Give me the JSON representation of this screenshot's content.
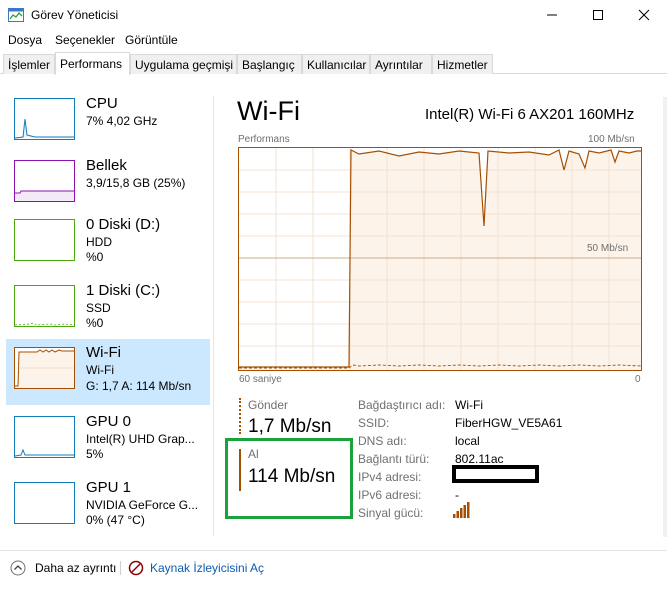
{
  "window": {
    "title": "Görev Yöneticisi",
    "icon": "task-manager-icon"
  },
  "menu": [
    "Dosya",
    "Seçenekler",
    "Görüntüle"
  ],
  "tabs": [
    {
      "label": "İşlemler",
      "active": false
    },
    {
      "label": "Performans",
      "active": true
    },
    {
      "label": "Uygulama geçmişi",
      "active": false
    },
    {
      "label": "Başlangıç",
      "active": false
    },
    {
      "label": "Kullanıcılar",
      "active": false
    },
    {
      "label": "Ayrıntılar",
      "active": false
    },
    {
      "label": "Hizmetler",
      "active": false
    }
  ],
  "sidebar": [
    {
      "name": "CPU",
      "sub1": "7% 4,02 GHz",
      "sub2": "",
      "sub3": "",
      "color": "#117dbb",
      "selected": false
    },
    {
      "name": "Bellek",
      "sub1": "3,9/15,8 GB (25%)",
      "sub2": "",
      "sub3": "",
      "color": "#8b12ae",
      "selected": false
    },
    {
      "name": "0 Diski (D:)",
      "sub1": "HDD",
      "sub2": "%0",
      "sub3": "",
      "color": "#4da60c",
      "selected": false
    },
    {
      "name": "1 Diski (C:)",
      "sub1": "SSD",
      "sub2": "%0",
      "sub3": "",
      "color": "#4da60c",
      "selected": false
    },
    {
      "name": "Wi-Fi",
      "sub1": "Wi-Fi",
      "sub2": "G: 1,7 A: 114 Mb/sn",
      "sub3": "",
      "color": "#a74f01",
      "selected": true
    },
    {
      "name": "GPU 0",
      "sub1": "Intel(R) UHD Grap...",
      "sub2": "5%",
      "sub3": "",
      "color": "#117dbb",
      "selected": false
    },
    {
      "name": "GPU 1",
      "sub1": "NVIDIA GeForce G...",
      "sub2": "0% (47 °C)",
      "sub3": "",
      "color": "#117dbb",
      "selected": false
    }
  ],
  "main": {
    "title": "Wi-Fi",
    "adapter": "Intel(R) Wi-Fi 6 AX201 160MHz",
    "graph": {
      "caption": "Performans",
      "max_label": "100 Mb/sn",
      "mid_label": "50 Mb/sn",
      "x_left": "60 saniye",
      "x_right": "0",
      "color": "#a74f01",
      "fill": "#fcf3eb"
    },
    "send": {
      "label": "Gönder",
      "value": "1,7 Mb/sn"
    },
    "receive": {
      "label": "Al",
      "value": "114 Mb/sn"
    },
    "properties": [
      {
        "label": "Bağdaştırıcı adı:",
        "value": "Wi-Fi"
      },
      {
        "label": "SSID:",
        "value": "FiberHGW_VE5A61"
      },
      {
        "label": "DNS adı:",
        "value": "local"
      },
      {
        "label": "Bağlantı türü:",
        "value": "802.11ac"
      },
      {
        "label": "IPv4 adresi:",
        "value": ""
      },
      {
        "label": "IPv6 adresi:",
        "value": "-"
      },
      {
        "label": "Sinyal gücü:",
        "value": ""
      }
    ]
  },
  "footer": {
    "less_details": "Daha az ayrıntı",
    "resource_monitor": "Kaynak İzleyicisini Aç"
  }
}
